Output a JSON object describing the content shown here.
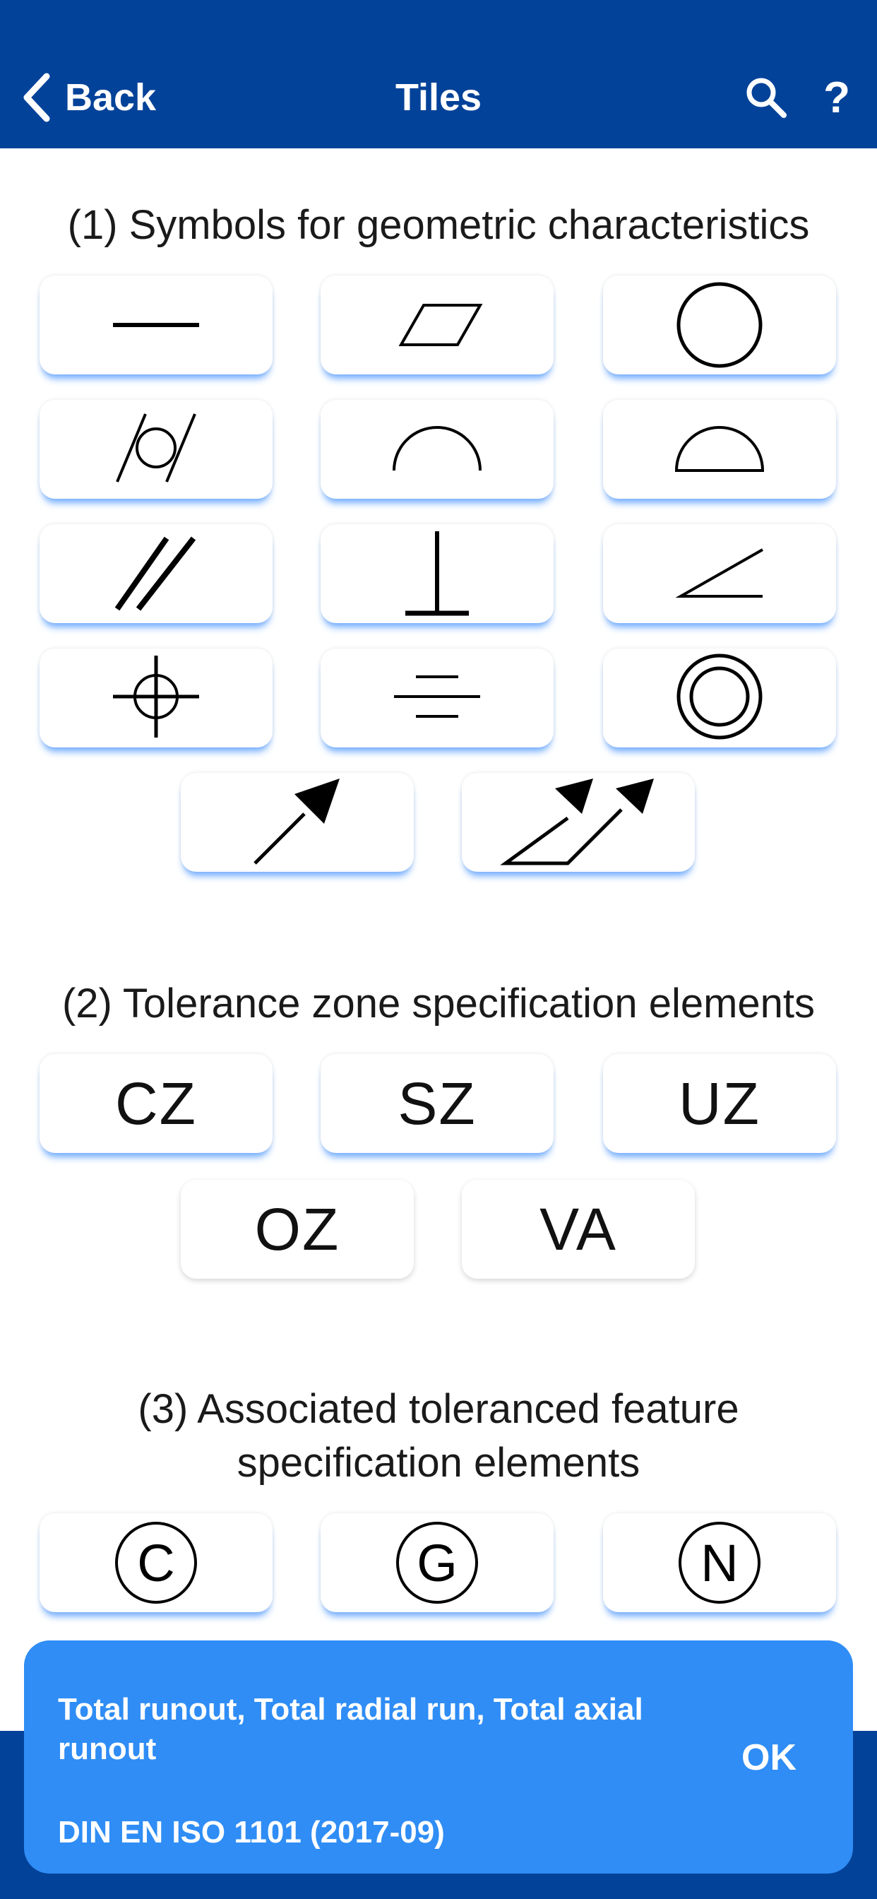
{
  "header": {
    "back_label": "Back",
    "title": "Tiles",
    "search_icon": "search-icon",
    "help_label": "?"
  },
  "sections": [
    {
      "title": "(1) Symbols for geometric characteristics"
    },
    {
      "title": "(2) Tolerance zone specification elements"
    },
    {
      "title_line1": "(3) Associated toleranced feature",
      "title_line2": "specification elements"
    }
  ],
  "section1_tiles": [
    "straightness-icon",
    "flatness-icon",
    "roundness-icon",
    "cylindricity-icon",
    "line-profile-icon",
    "surface-profile-icon",
    "parallelism-icon",
    "perpendicularity-icon",
    "angularity-icon",
    "position-icon",
    "symmetry-icon",
    "concentricity-icon",
    "circular-runout-icon",
    "total-runout-icon"
  ],
  "section2_tiles": [
    "CZ",
    "SZ",
    "UZ",
    "OZ",
    "VA"
  ],
  "section3_tiles": [
    "C",
    "G",
    "N"
  ],
  "toast": {
    "line1": "Total runout, Total radial run, Total axial",
    "line2": "runout",
    "line3": "DIN EN ISO 1101 (2017-09)",
    "ok_label": "OK"
  },
  "colors": {
    "header": "#034299",
    "toast": "#2f8df5",
    "tile_shadow": "#5ca0ff"
  }
}
